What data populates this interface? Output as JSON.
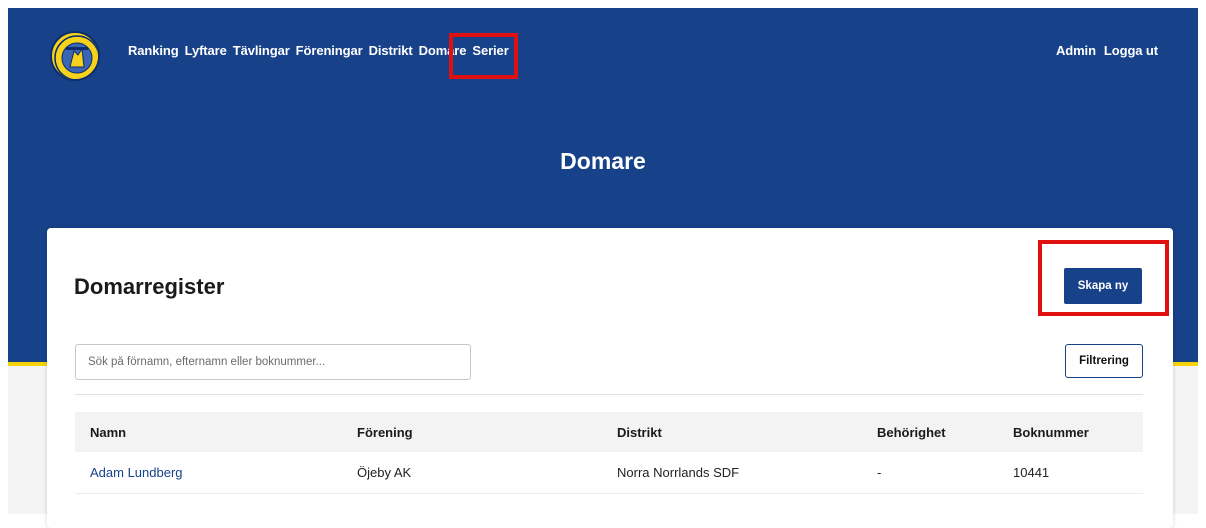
{
  "nav": {
    "items": [
      "Ranking",
      "Lyftare",
      "Tävlingar",
      "Föreningar",
      "Distrikt",
      "Domare",
      "Serier"
    ],
    "right": [
      "Admin",
      "Logga ut"
    ]
  },
  "hero": {
    "title": "Domare"
  },
  "card": {
    "title": "Domarregister",
    "create_label": "Skapa ny",
    "search_placeholder": "Sök på förnamn, efternamn eller boknummer...",
    "filter_label": "Filtrering"
  },
  "table": {
    "headers": [
      "Namn",
      "Förening",
      "Distrikt",
      "Behörighet",
      "Boknummer"
    ],
    "rows": [
      [
        "Adam Lundberg",
        "Öjeby AK",
        "Norra Norrlands SDF",
        "-",
        "10441"
      ]
    ]
  },
  "colors": {
    "brand": "#174189",
    "accent": "#f5d20a",
    "highlight": "#e01010"
  }
}
